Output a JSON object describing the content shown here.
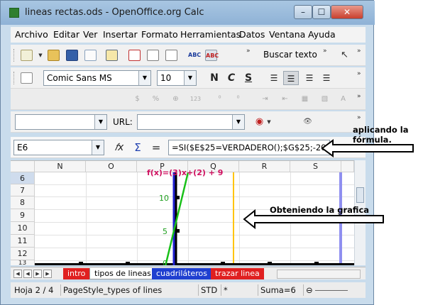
{
  "window": {
    "title": "lineas rectas.ods - OpenOffice.org Calc"
  },
  "window_buttons": {
    "min": "–",
    "max": "☐",
    "close": "✕"
  },
  "menu": [
    "Archivo",
    "Editar",
    "Ver",
    "Insertar",
    "Formato",
    "Herramientas",
    "Datos",
    "Ventana",
    "Ayuda"
  ],
  "toolbar": {
    "find_label": "Buscar texto"
  },
  "format": {
    "font_name": "Comic Sans MS",
    "font_size": "10",
    "bold": "N",
    "italic": "C",
    "underline": "S",
    "number_format_label": "123"
  },
  "navbar": {
    "url_label": "URL:"
  },
  "formula": {
    "cell_ref": "E6",
    "function_icon": "𝑓x",
    "sum_icon": "Σ",
    "equals": "=",
    "content": "=SI($E$25=VERDADERO();$G$25;-20)"
  },
  "grid": {
    "columns": [
      "N",
      "O",
      "P",
      "Q",
      "R",
      "S"
    ],
    "rows": [
      "6",
      "7",
      "8",
      "9",
      "10",
      "11",
      "12",
      "13"
    ],
    "selected_row": "6"
  },
  "chart_overlay": {
    "formula_text": "f(x)=(3)x+(2) + 9",
    "tick_labels": [
      "10",
      "5",
      "0"
    ]
  },
  "tabs": [
    {
      "label": "intro",
      "color": "#e02020"
    },
    {
      "label": "tipos de lineas",
      "color": "#ffffff",
      "active": true
    },
    {
      "label": "cuadriláteros",
      "color": "#1f3fd0"
    },
    {
      "label": "trazar linea",
      "color": "#e02020"
    }
  ],
  "status": {
    "sheet": "Hoja 2 / 4",
    "style": "PageStyle_types of lines",
    "mode": "STD",
    "modified": "*",
    "sum": "Suma=6"
  },
  "annotations": {
    "formula_note": "aplicando la\nfórmula.",
    "chart_note": "Obteniendo la grafica"
  }
}
